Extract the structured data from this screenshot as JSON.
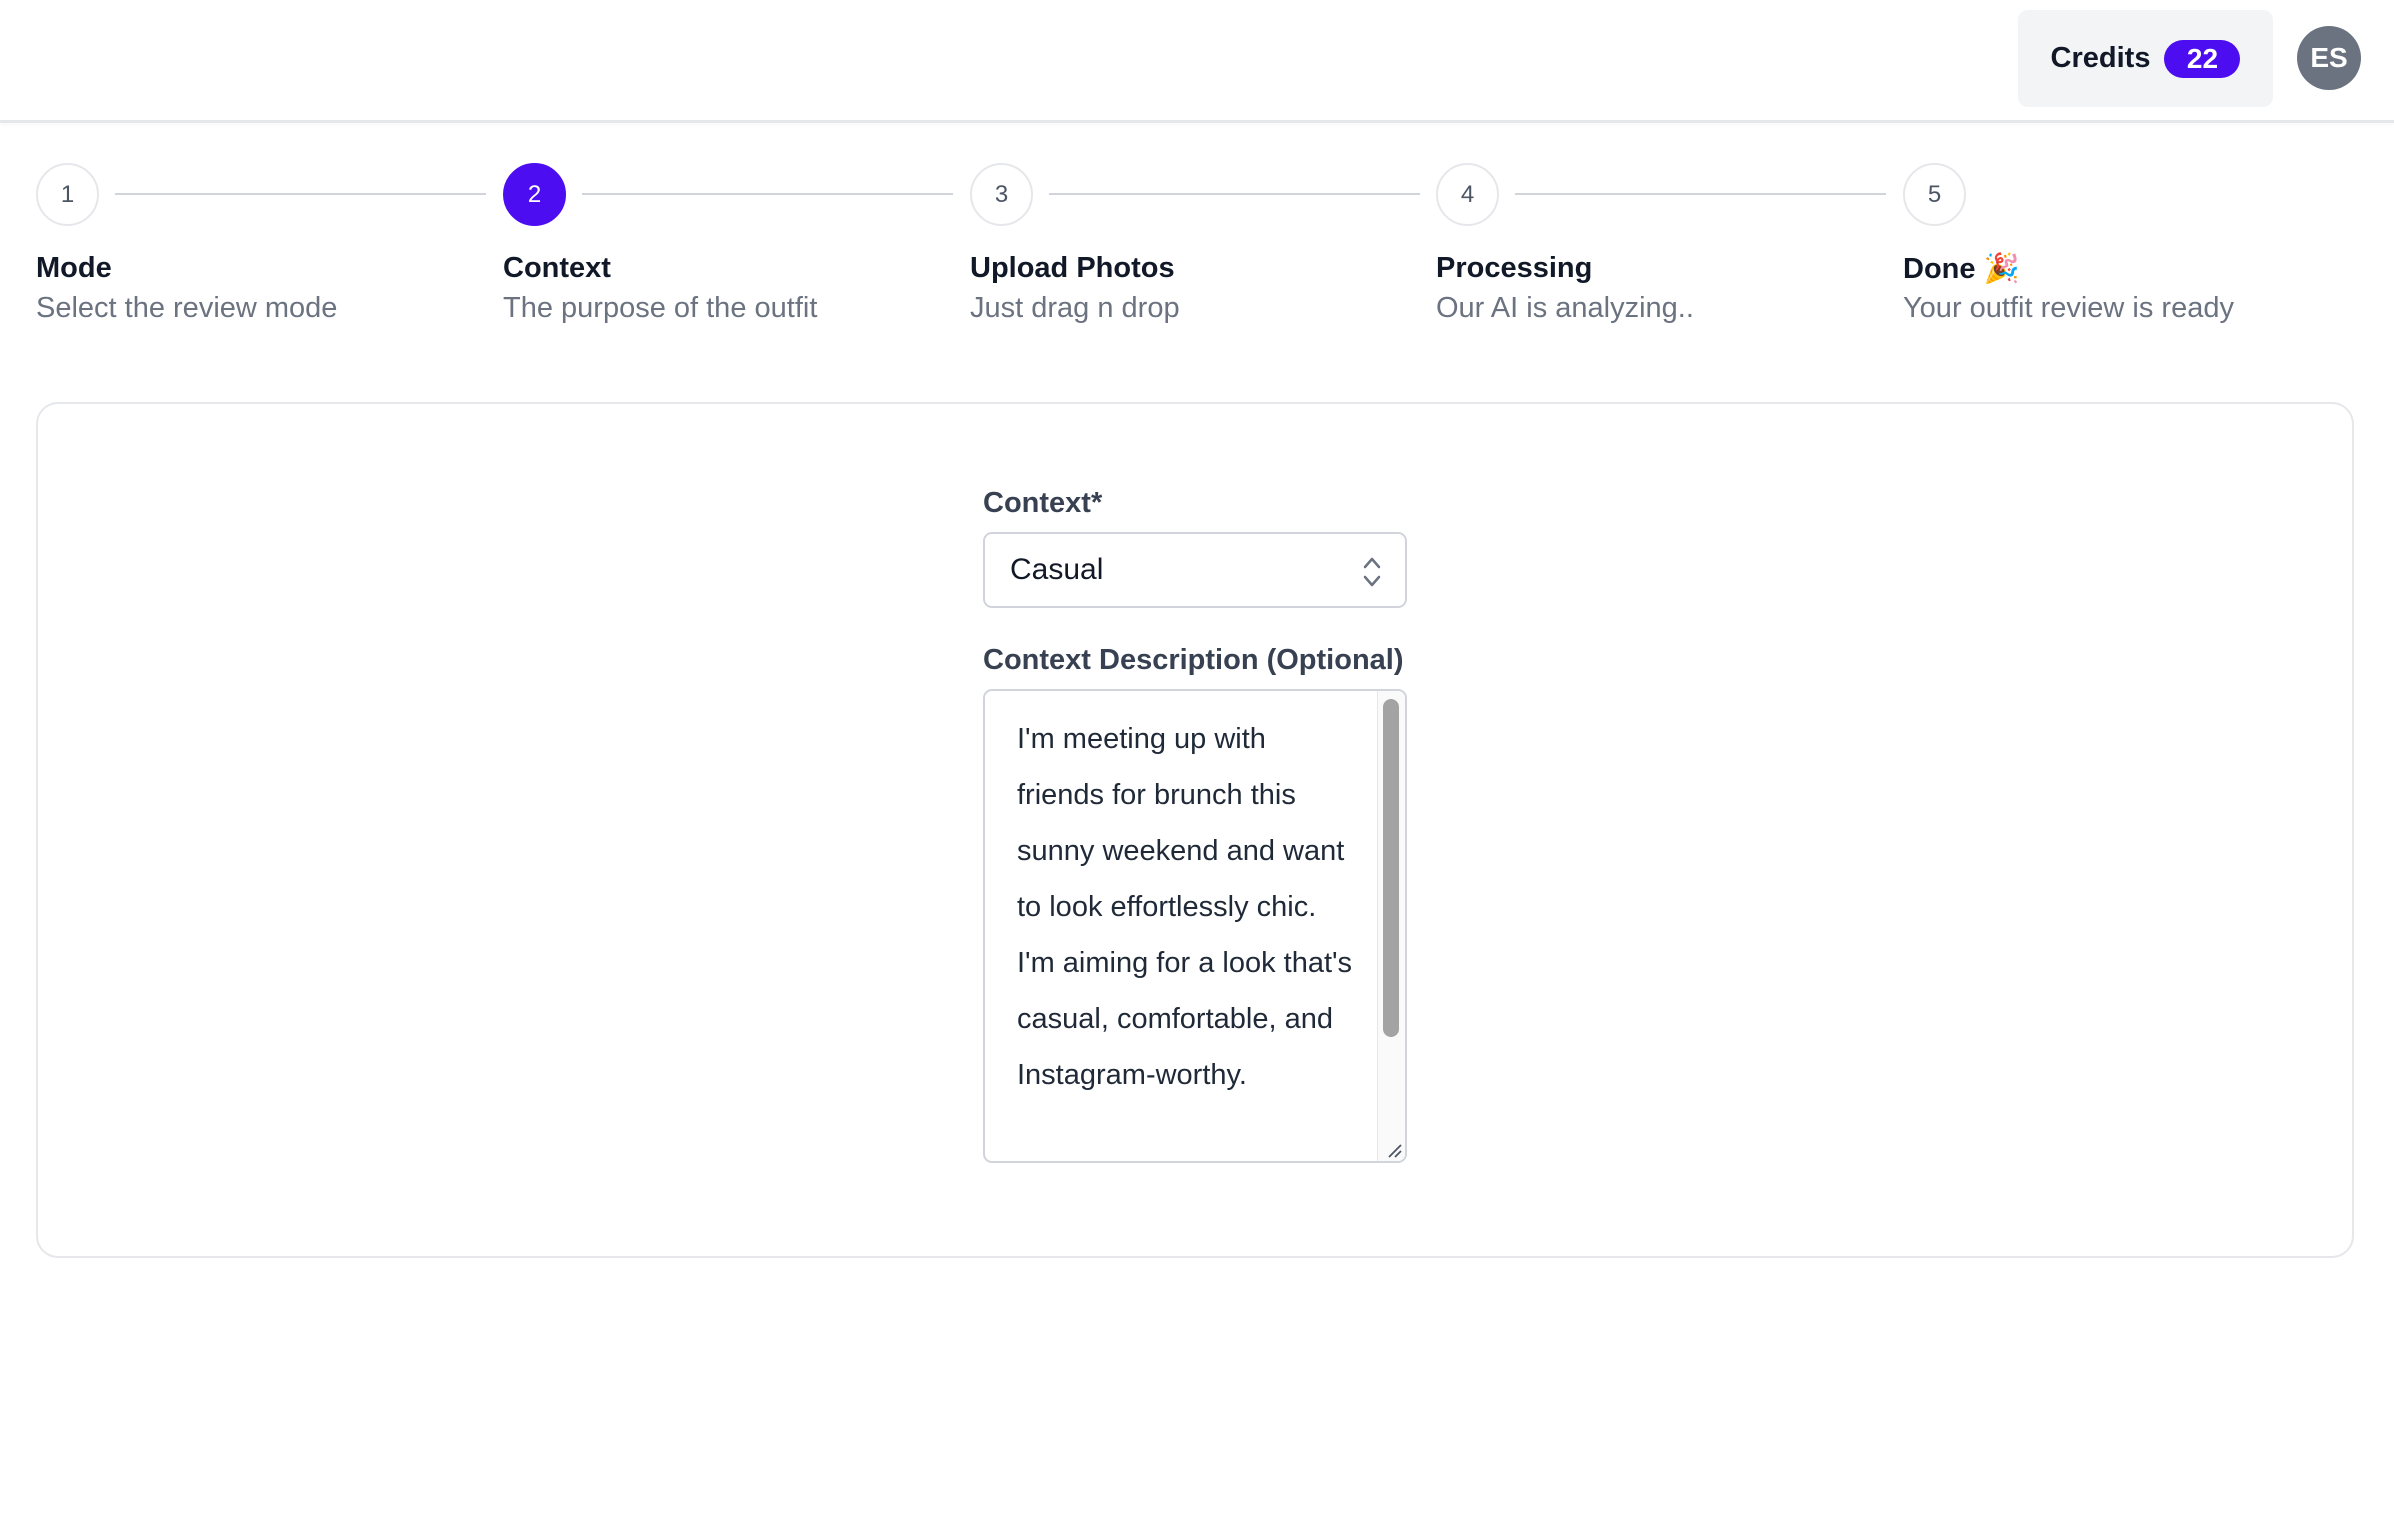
{
  "header": {
    "credits_label": "Credits",
    "credits_count": "22",
    "avatar_initials": "ES"
  },
  "stepper": {
    "current_step": 2,
    "steps": [
      {
        "number": "1",
        "title": "Mode",
        "subtitle": "Select the review mode"
      },
      {
        "number": "2",
        "title": "Context",
        "subtitle": "The purpose of the outfit"
      },
      {
        "number": "3",
        "title": "Upload Photos",
        "subtitle": "Just drag n drop"
      },
      {
        "number": "4",
        "title": "Processing",
        "subtitle": "Our AI is analyzing.."
      },
      {
        "number": "5",
        "title": "Done 🎉",
        "subtitle": "Your outfit review is ready"
      }
    ]
  },
  "form": {
    "context_label": "Context*",
    "context_value": "Casual",
    "description_label": "Context Description (Optional)",
    "description_value": "I'm meeting up with friends for brunch this sunny weekend and want to look effortlessly chic. I'm aiming for a look that's casual, comfortable, and Instagram-worthy."
  },
  "colors": {
    "accent": "#4c0ef0",
    "border": "#e5e7eb",
    "muted_text": "#6b7280"
  },
  "icons": {
    "select": "chevron-up-down-icon",
    "resize": "resize-handle-icon"
  }
}
